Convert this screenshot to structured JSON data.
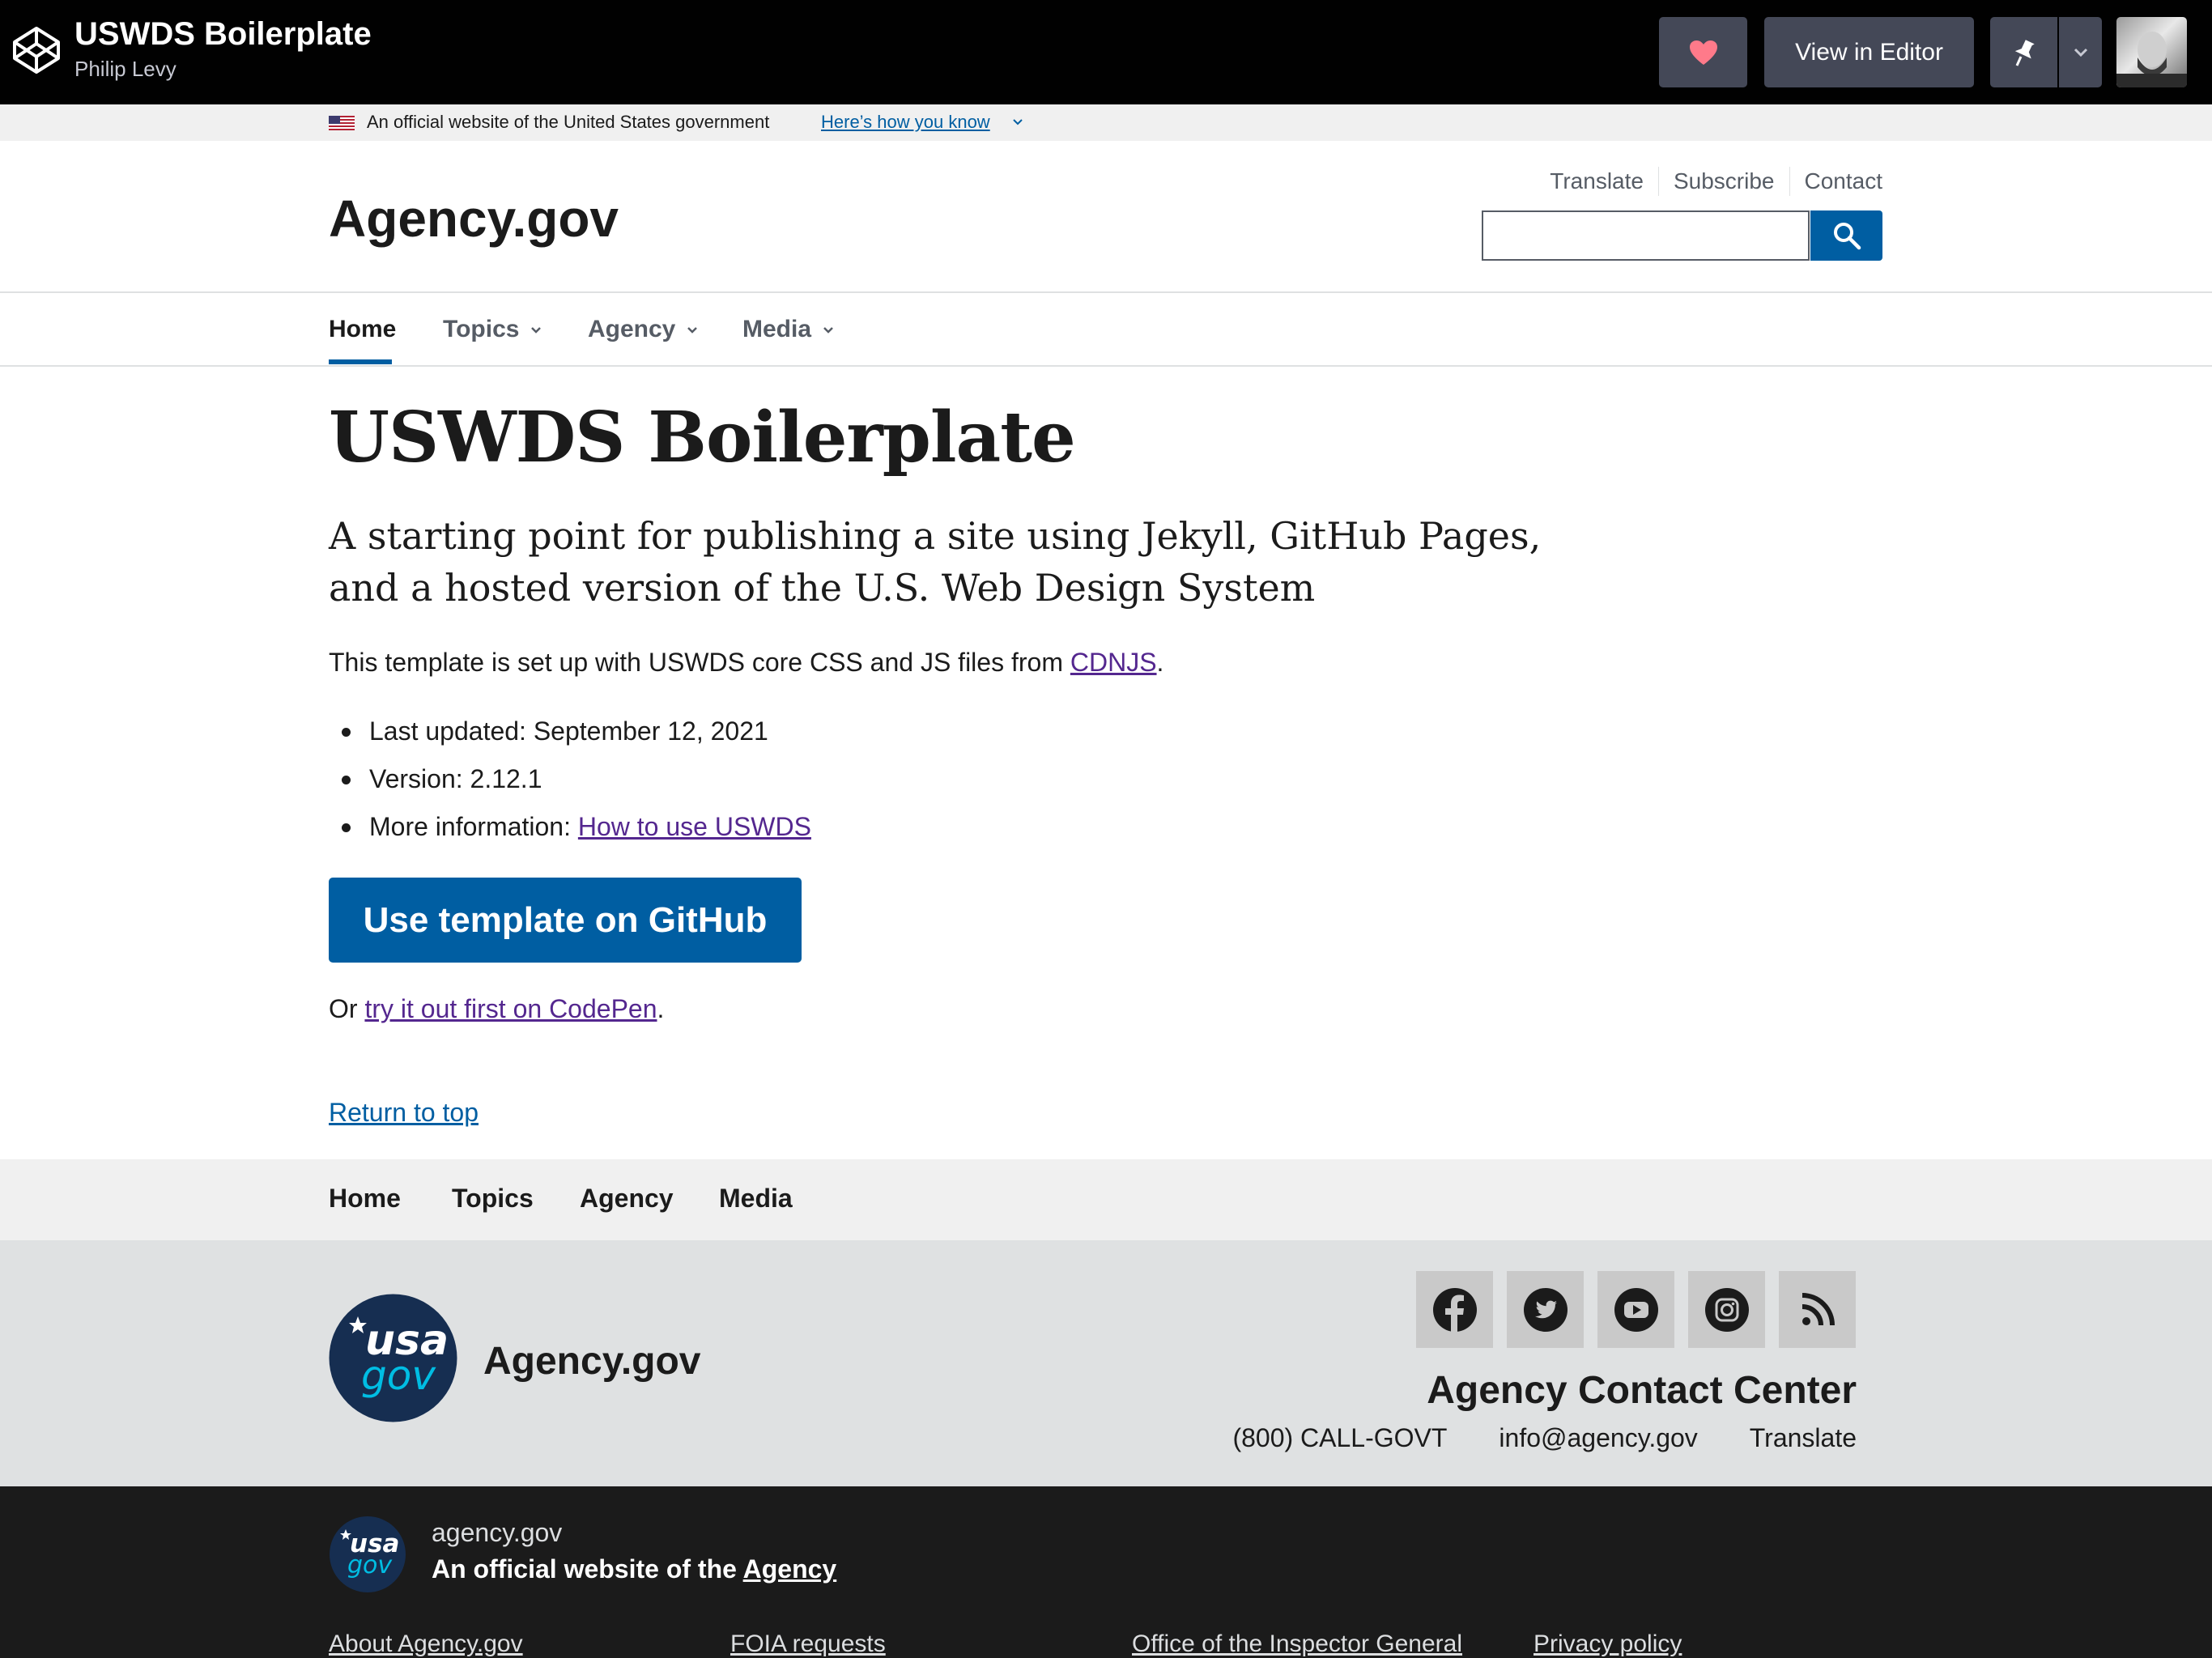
{
  "codepen": {
    "pen_title": "USWDS Boilerplate",
    "author": "Philip Levy",
    "view_in_editor": "View in Editor",
    "icons": {
      "logo": "codepen-logo-icon",
      "heart": "heart-icon",
      "pin": "pin-icon",
      "dropdown": "chevron-down-icon"
    }
  },
  "banner": {
    "text": "An official website of the United States government",
    "link": "Here’s how you know"
  },
  "header": {
    "title": "Agency.gov",
    "utility_nav": [
      "Translate",
      "Subscribe",
      "Contact"
    ],
    "search": {
      "value": "",
      "placeholder": ""
    }
  },
  "primary_nav": {
    "items": [
      {
        "label": "Home",
        "current": true
      },
      {
        "label": "Topics",
        "current": false
      },
      {
        "label": "Agency",
        "current": false
      },
      {
        "label": "Media",
        "current": false
      }
    ]
  },
  "main": {
    "title": "USWDS Boilerplate",
    "lead": "A starting point for publishing a site using Jekyll, GitHub Pages, and a hosted version of the U.S. Web Design System",
    "intro_prefix": "This template is set up with USWDS core CSS and JS files from ",
    "intro_link": "CDNJS",
    "intro_suffix": ".",
    "list": {
      "updated_label": "Last updated: ",
      "updated_value": "September 12, 2021",
      "version_label": "Version: ",
      "version_value": "2.12.1",
      "more_label": "More information: ",
      "more_link": "How to use USWDS"
    },
    "cta_button": "Use template on GitHub",
    "or_prefix": "Or ",
    "or_link": "try it out first on CodePen",
    "or_suffix": ".",
    "return_top": "Return to top"
  },
  "footer_nav": [
    "Home",
    "Topics",
    "Agency",
    "Media"
  ],
  "footer": {
    "logo_text_top": "usa",
    "logo_text_bottom": "gov",
    "agency_name": "Agency.gov",
    "social_icons": [
      "facebook-icon",
      "twitter-icon",
      "youtube-icon",
      "instagram-icon",
      "rss-icon"
    ],
    "contact_heading": "Agency Contact Center",
    "phone": "(800) CALL-GOVT",
    "email": "info@agency.gov",
    "translate": "Translate"
  },
  "identifier": {
    "domain": "agency.gov",
    "official_prefix": "An official website of the ",
    "official_link": "Agency",
    "links": [
      "About Agency.gov",
      "FOIA requests",
      "Office of the Inspector General",
      "Privacy policy"
    ]
  },
  "colors": {
    "primary": "#005ea2",
    "visited_link": "#54278f",
    "codepen_bar": "#010101",
    "identifier_bg": "#1b1b1b",
    "heart": "#ff7a8a"
  }
}
